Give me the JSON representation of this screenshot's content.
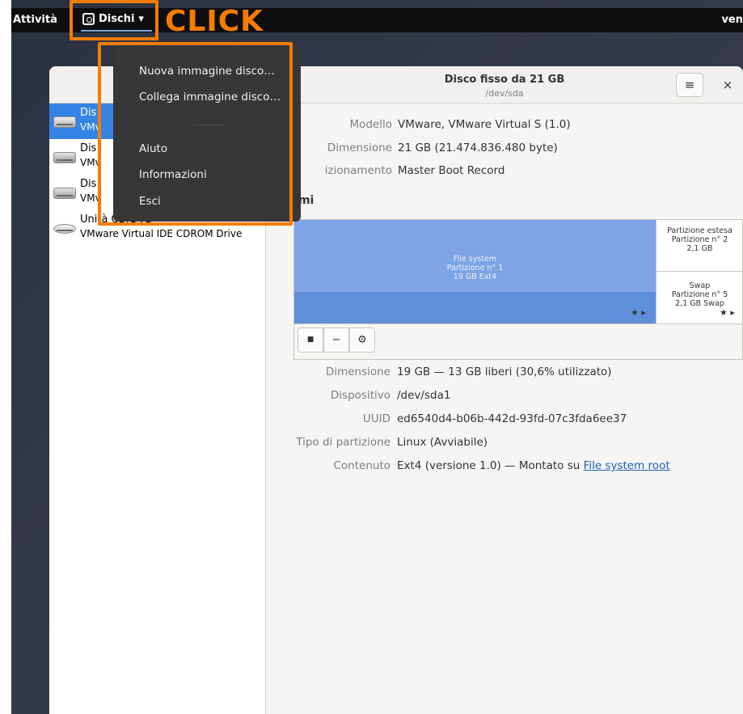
{
  "topbar": {
    "activities": "Attività",
    "app_menu_label": "Dischi",
    "app_menu_arrow": "▾",
    "clock_partial": "ven"
  },
  "app_menu": {
    "items": [
      "Nuova immagine disco…",
      "Collega immagine disco…",
      "Aiuto",
      "Informazioni",
      "Esci"
    ]
  },
  "annotation": {
    "click_label": "CLICK",
    "color": "#f57c00"
  },
  "window": {
    "title": "Disco fisso da 21 GB",
    "subtitle": "/dev/sda",
    "menu_icon": "≡",
    "close_icon": "×"
  },
  "drives": [
    {
      "name": "Dis",
      "model": "VMv",
      "selected": true,
      "icon": "hard-disk-icon"
    },
    {
      "name": "Dis",
      "model": "VMv",
      "selected": false,
      "icon": "hard-disk-icon"
    },
    {
      "name": "Dis",
      "model": "VMv",
      "selected": false,
      "icon": "hard-disk-icon"
    },
    {
      "name": "Unità CD/DVD",
      "model": "VMware Virtual IDE CDROM Drive",
      "selected": false,
      "icon": "optical-drive-icon"
    }
  ],
  "disk_info": {
    "model_label": "Modello",
    "model_value": "VMware, VMware Virtual S (1.0)",
    "size_label": "Dimensione",
    "size_value": "21 GB (21.474.836.480 byte)",
    "partitioning_label": "izionamento",
    "partitioning_value": "Master Boot Record"
  },
  "volumes": {
    "heading": "umi",
    "fs_segment": [
      "File system",
      "Partizione n° 1",
      "19 GB Ext4"
    ],
    "extended_segment": [
      "Partizione estesa",
      "Partizione n° 2",
      "2,1 GB"
    ],
    "swap_segment": [
      "Swap",
      "Partizione n° 5",
      "2,1 GB Swap"
    ],
    "star_glyph": "★ ▸",
    "toolbar": {
      "stop": "■",
      "minus": "−",
      "gear": "⚙"
    }
  },
  "partition_info": {
    "size_label": "Dimensione",
    "size_value": "19 GB — 13 GB liberi (30,6% utilizzato)",
    "device_label": "Dispositivo",
    "device_value": "/dev/sda1",
    "uuid_label": "UUID",
    "uuid_value": "ed6540d4-b06b-442d-93fd-07c3fda6ee37",
    "type_label": "Tipo di partizione",
    "type_value": "Linux (Avviabile)",
    "content_label": "Contenuto",
    "content_value": "Ext4 (versione 1.0) — Montato su ",
    "content_link": "File system root"
  }
}
